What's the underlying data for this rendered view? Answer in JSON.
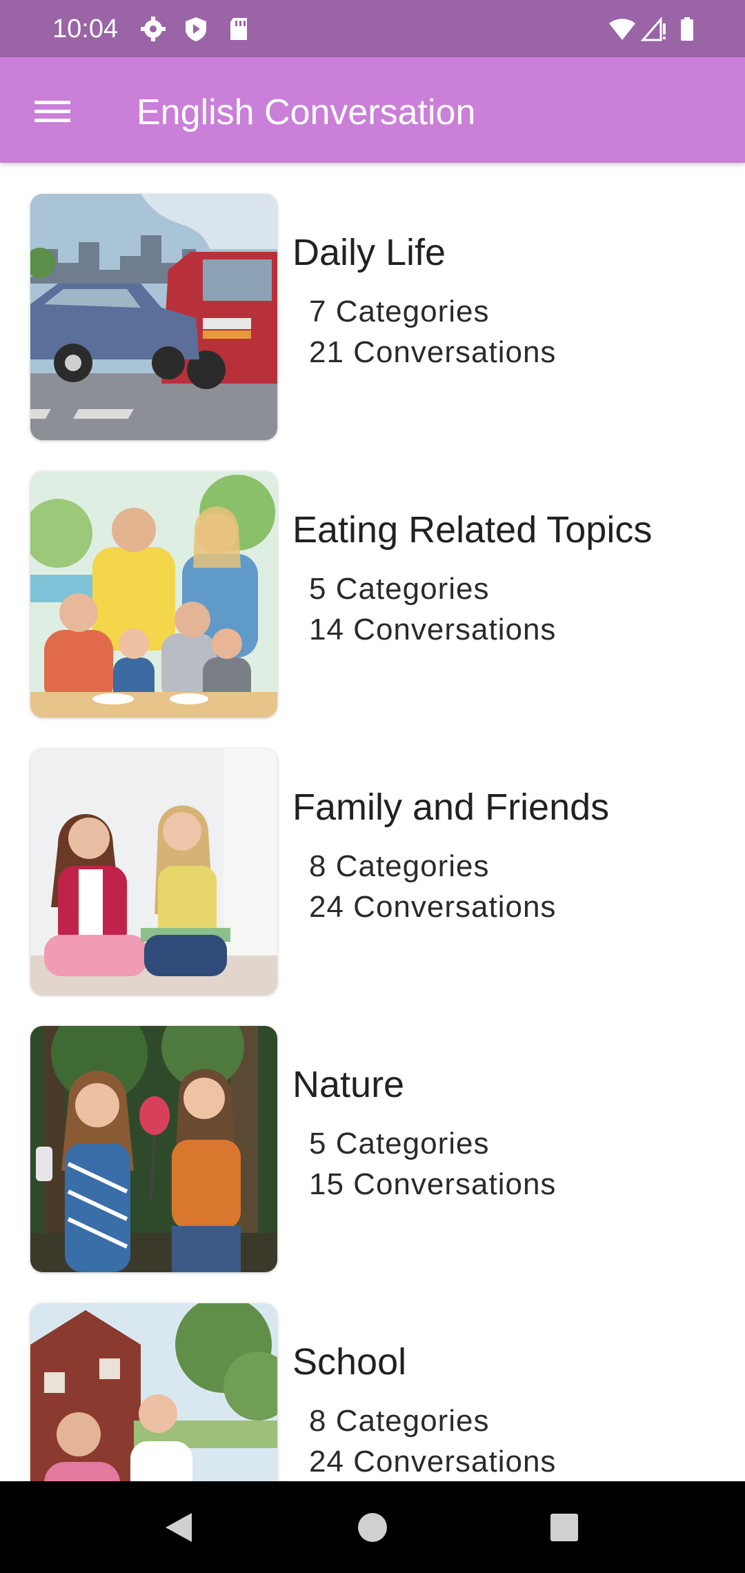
{
  "status_bar": {
    "time": "10:04"
  },
  "app_bar": {
    "title": "English Conversation"
  },
  "topics": [
    {
      "title": "Daily Life",
      "categories": "7 Categories",
      "conversations": "21 Conversations"
    },
    {
      "title": "Eating Related Topics",
      "categories": "5 Categories",
      "conversations": "14 Conversations"
    },
    {
      "title": "Family and Friends",
      "categories": "8 Categories",
      "conversations": "24 Conversations"
    },
    {
      "title": "Nature",
      "categories": "5 Categories",
      "conversations": "15 Conversations"
    },
    {
      "title": "School",
      "categories": "8 Categories",
      "conversations": "24 Conversations"
    }
  ],
  "colors": {
    "status_bar": "#9b64a6",
    "app_bar": "#ca7fd8",
    "nav_bar": "#000000"
  }
}
